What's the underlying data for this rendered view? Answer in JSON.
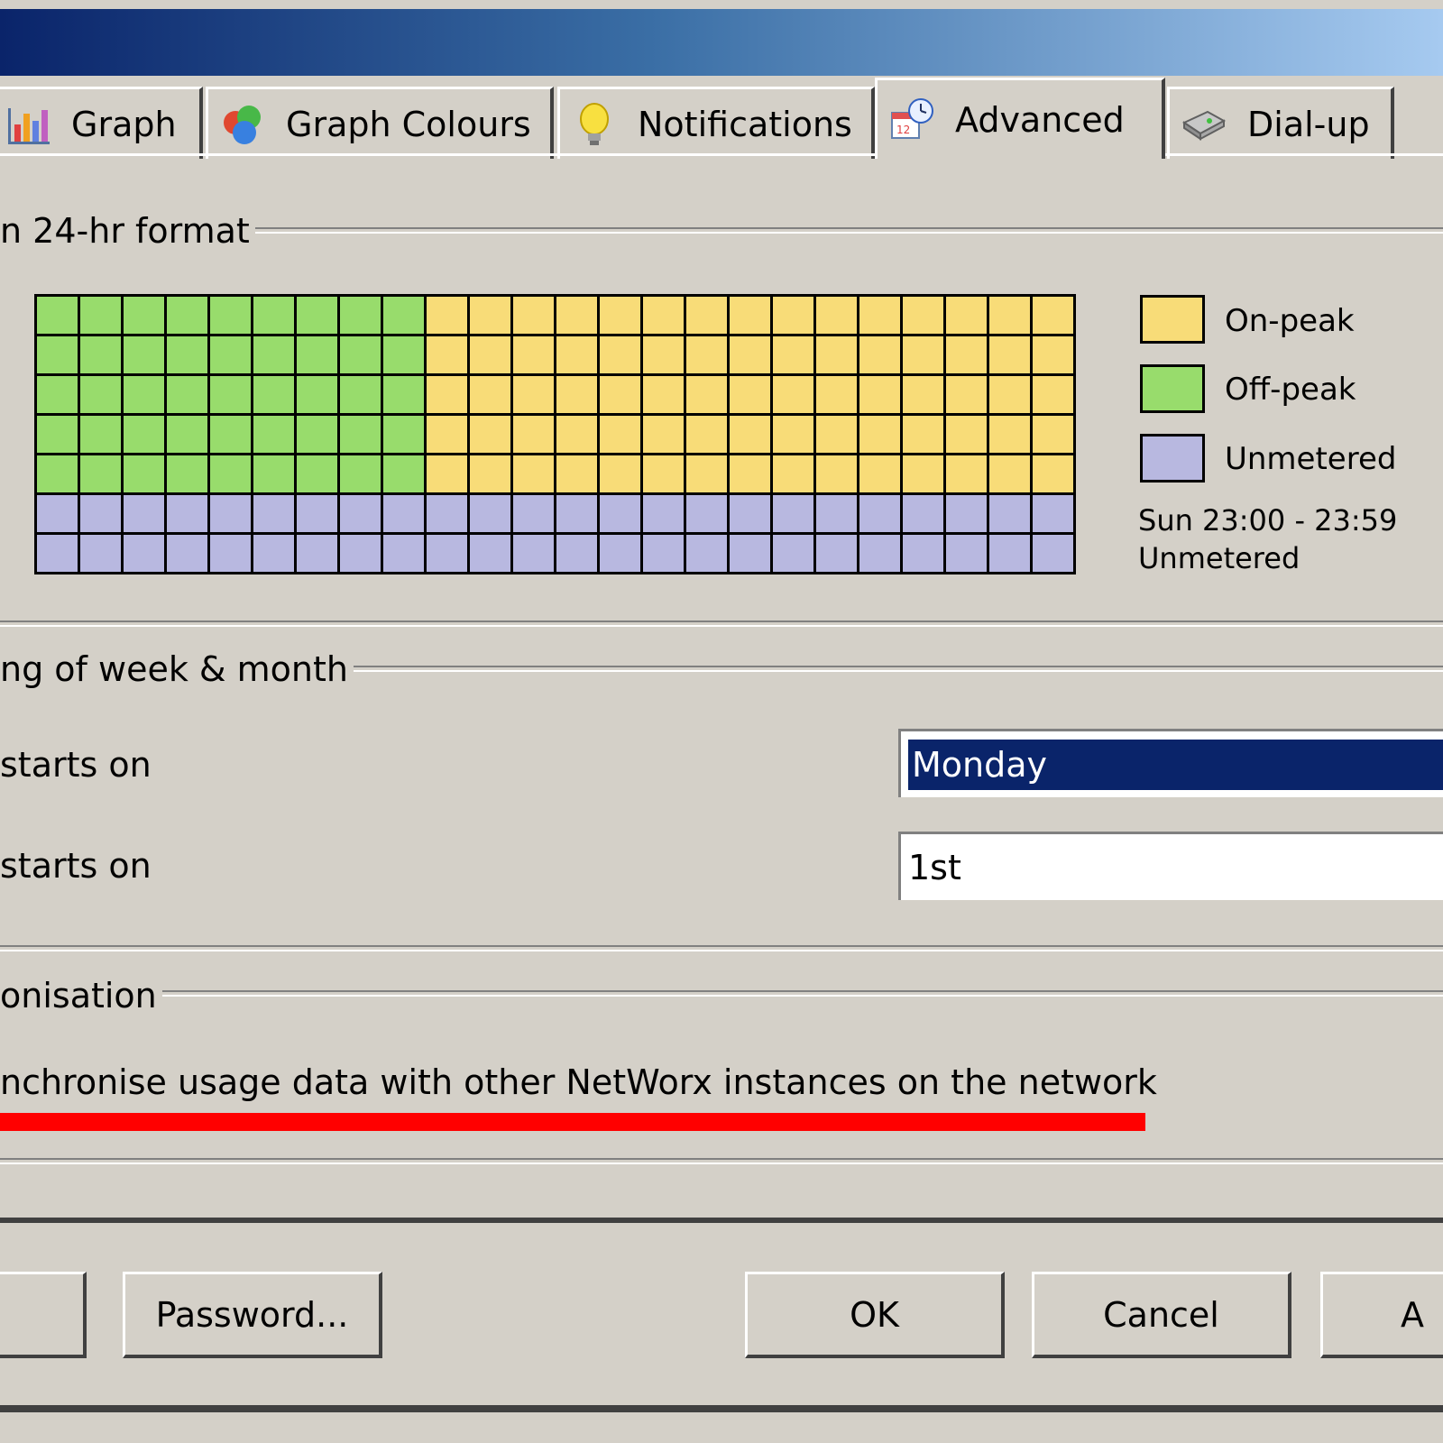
{
  "tabs": [
    {
      "label": "Graph",
      "icon": "bar-chart-icon"
    },
    {
      "label": "Graph Colours",
      "icon": "color-balls-icon"
    },
    {
      "label": "Notifications",
      "icon": "light-bulb-icon"
    },
    {
      "label": "Advanced",
      "icon": "calendar-clock-icon",
      "active": true
    },
    {
      "label": "Dial-up",
      "icon": "modem-icon"
    }
  ],
  "schedule": {
    "group_label": "n 24-hr format",
    "rows": 7,
    "columns": 24,
    "cells": [
      "GGGGGGGGGYYYYYYYYYYYYYYY",
      "GGGGGGGGGYYYYYYYYYYYYYYY",
      "GGGGGGGGGYYYYYYYYYYYYYYY",
      "GGGGGGGGGYYYYYYYYYYYYYYY",
      "GGGGGGGGGYYYYYYYYYYYYYYY",
      "UUUUUUUUUUUUUUUUUUUUUUUU",
      "UUUUUUUUUUUUUUUUUUUUUUUU"
    ],
    "colors": {
      "Y": "#f8dc78",
      "G": "#98dc6c",
      "U": "#b8b8e0"
    },
    "legend": [
      {
        "label": "On-peak",
        "color": "#f8dc78"
      },
      {
        "label": "Off-peak",
        "color": "#98dc6c"
      },
      {
        "label": "Unmetered",
        "color": "#b8b8e0"
      }
    ],
    "status_line1": "Sun 23:00 - 23:59",
    "status_line2": "Unmetered"
  },
  "week_month": {
    "group_label": "ng of week & month",
    "week_label": "starts on",
    "week_value": "Monday",
    "month_label": "starts on",
    "month_value": "1st"
  },
  "sync": {
    "group_label": "onisation",
    "checkbox_label": "nchronise usage data with other NetWorx instances on the network"
  },
  "buttons": {
    "password": "Password...",
    "ok": "OK",
    "cancel": "Cancel",
    "apply_partial": "A"
  }
}
